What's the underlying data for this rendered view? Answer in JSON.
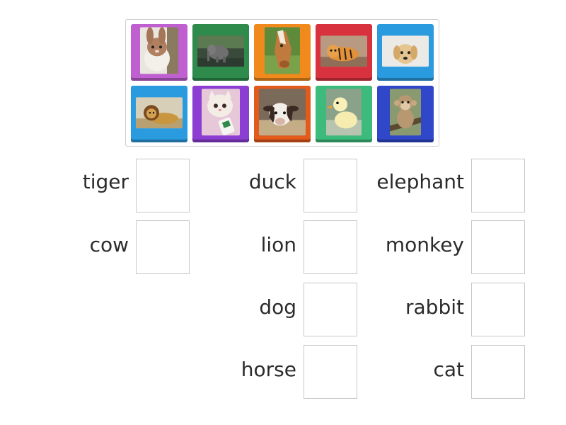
{
  "tiles": [
    {
      "animal": "rabbit",
      "color": "#c05fd0",
      "icon": "rabbit-photo"
    },
    {
      "animal": "elephant",
      "color": "#2e8b4c",
      "icon": "elephant-photo"
    },
    {
      "animal": "horse",
      "color": "#f08a1c",
      "icon": "horse-photo"
    },
    {
      "animal": "tiger",
      "color": "#d9323f",
      "icon": "tiger-photo"
    },
    {
      "animal": "dog",
      "color": "#2b9be0",
      "icon": "dog-photo"
    },
    {
      "animal": "lion",
      "color": "#2b9be0",
      "icon": "lion-photo"
    },
    {
      "animal": "cat",
      "color": "#8b3ed1",
      "icon": "cat-photo"
    },
    {
      "animal": "cow",
      "color": "#e25a1c",
      "icon": "cow-photo"
    },
    {
      "animal": "duck",
      "color": "#3dbb7c",
      "icon": "duck-photo"
    },
    {
      "animal": "monkey",
      "color": "#2f47c8",
      "icon": "monkey-photo"
    }
  ],
  "targets": {
    "tiger": "tiger",
    "cow": "cow",
    "duck": "duck",
    "lion": "lion",
    "dog": "dog",
    "horse": "horse",
    "elephant": "elephant",
    "monkey": "monkey",
    "rabbit": "rabbit",
    "cat": "cat"
  }
}
